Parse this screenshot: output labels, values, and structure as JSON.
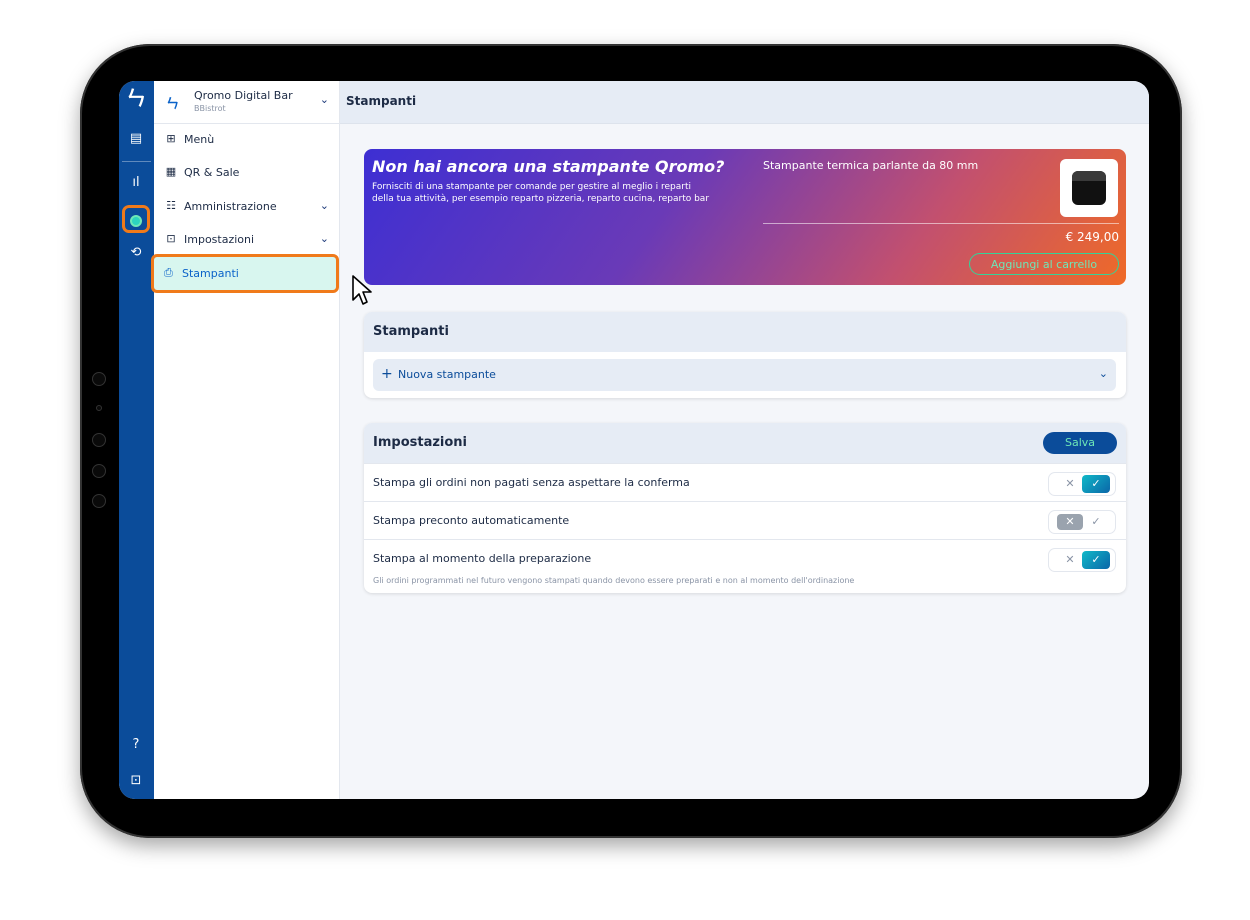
{
  "sidebar": {
    "workspace_name": "Qromo Digital Bar",
    "workspace_sub": "BBistrot",
    "items": [
      {
        "label": "Menù",
        "icon": "menu-book-icon"
      },
      {
        "label": "QR & Sale",
        "icon": "qr-code-icon"
      },
      {
        "label": "Amministrazione",
        "icon": "admin-icon"
      },
      {
        "label": "Impostazioni",
        "icon": "settings-icon"
      },
      {
        "label": "Stampanti",
        "icon": "printer-icon"
      }
    ]
  },
  "header": {
    "title": "Stampanti"
  },
  "promo": {
    "heading": "Non hai ancora una stampante Qromo?",
    "description": "Fornisciti di una stampante per comande per gestire al meglio i reparti della tua attività, per esempio reparto pizzeria, reparto cucina, reparto bar",
    "product_name": "Stampante termica parlante da 80 mm",
    "price": "€ 249,00",
    "cart_button": "Aggiungi al carrello"
  },
  "printers": {
    "title": "Stampanti",
    "add_label": "Nuova stampante"
  },
  "settings": {
    "title": "Impostazioni",
    "save_label": "Salva",
    "rows": [
      {
        "label": "Stampa gli ordini non pagati senza aspettare la conferma",
        "enabled": true
      },
      {
        "label": "Stampa preconto automaticamente",
        "enabled": false
      },
      {
        "label": "Stampa al momento della preparazione",
        "enabled": true,
        "hint": "Gli ordini programmati nel futuro vengono stampati quando devono essere preparati e non al momento dell'ordinazione"
      }
    ]
  },
  "colors": {
    "accent": "#0b4c9a",
    "highlight": "#f07a1a",
    "active_bg": "#d8f6ef"
  }
}
